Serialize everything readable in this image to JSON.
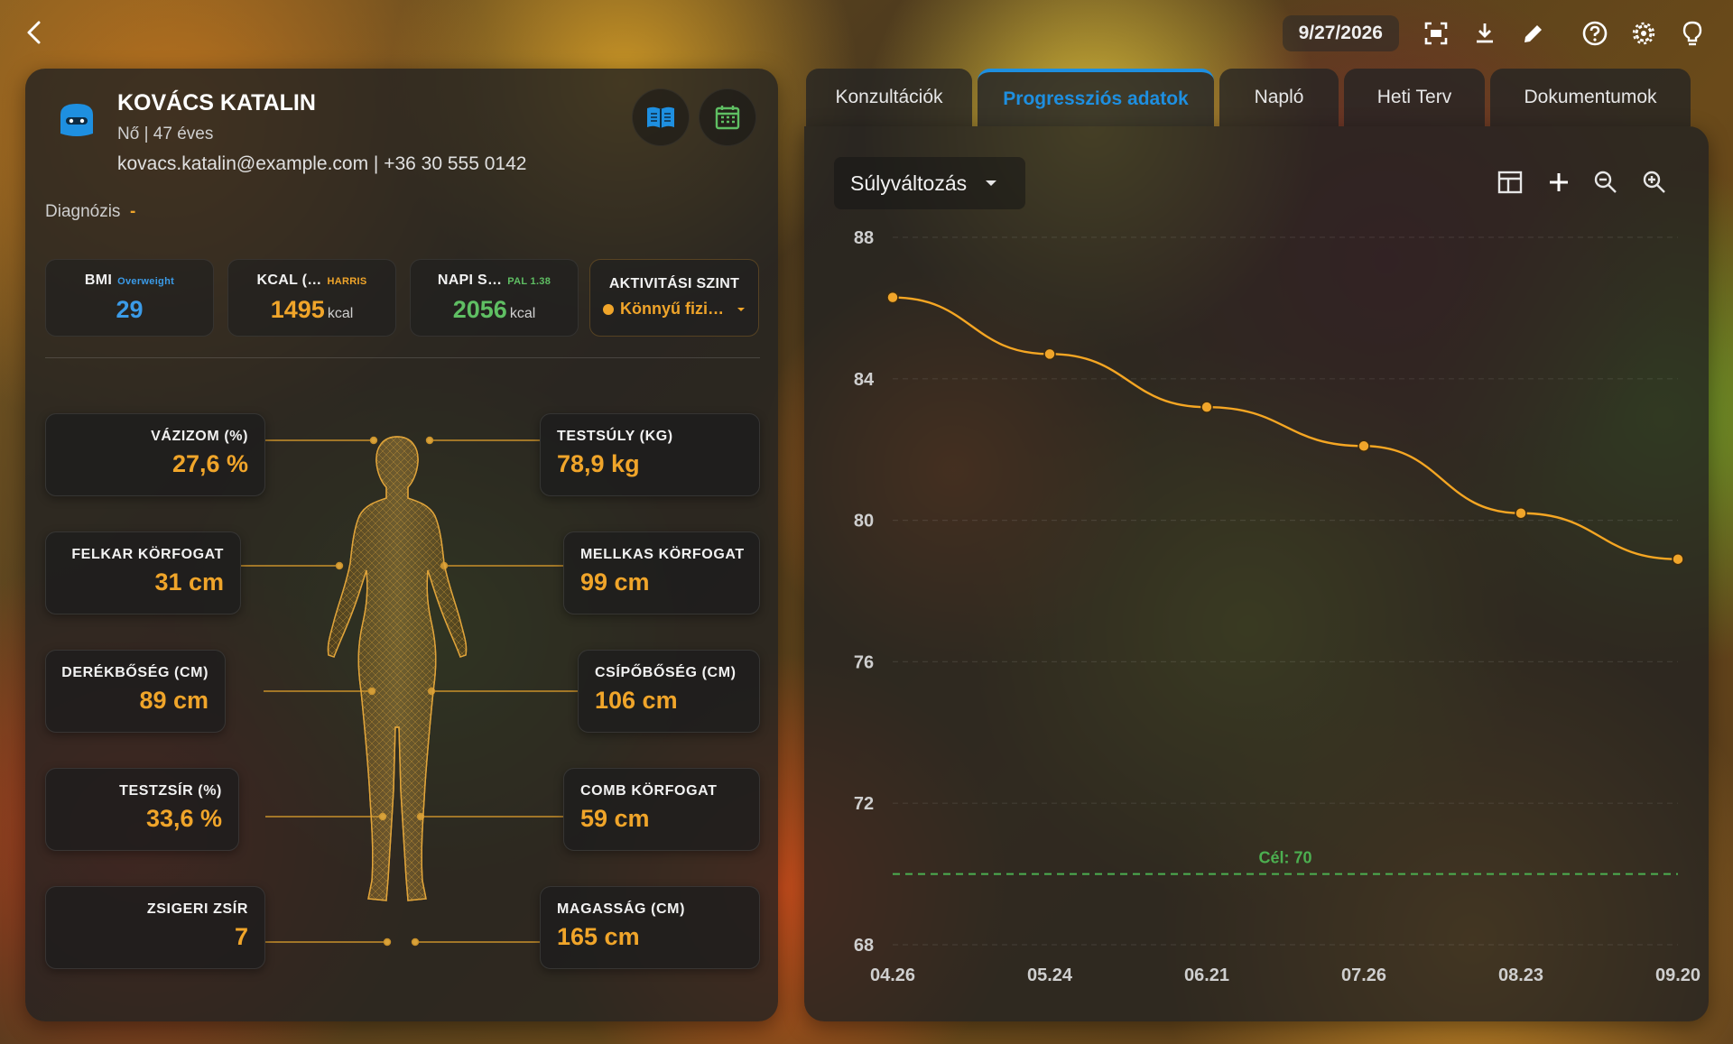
{
  "topbar": {
    "date": "9/27/2026",
    "icons": [
      "back-icon",
      "fullscreen-icon",
      "download-icon",
      "edit-icon",
      "help-icon",
      "settings-icon",
      "lightbulb-icon"
    ]
  },
  "patient": {
    "name": "KOVÁCS KATALIN",
    "meta": "Nő | 47 éves",
    "contact": "kovacs.katalin@example.com | +36 30 555 0142",
    "diagnosis_label": "Diagnózis",
    "diagnosis_value": "-"
  },
  "stats": {
    "bmi": {
      "title": "BMI",
      "tag": "Overweight",
      "value": "29",
      "tag_color": "#3b9be8",
      "value_color": "#3b9be8"
    },
    "kcal": {
      "title": "KCAL (…",
      "tag": "HARRIS",
      "value": "1495",
      "unit": "kcal",
      "tag_color": "#f0a52a",
      "value_color": "#f0a52a"
    },
    "napi": {
      "title": "NAPI S…",
      "tag": "PAL 1.38",
      "value": "2056",
      "unit": "kcal",
      "tag_color": "#5fbf63",
      "value_color": "#5fbf63"
    },
    "activity": {
      "title": "AKTIVITÁSI SZINT",
      "value": "Könnyű fizi…"
    }
  },
  "measurements": {
    "vazizom": {
      "label": "VÁZIZOM (%)",
      "value": "27,6 %"
    },
    "testsuly": {
      "label": "TESTSÚLY (KG)",
      "value": "78,9 kg"
    },
    "felkar": {
      "label": "FELKAR KÖRFOGAT",
      "value": "31 cm"
    },
    "mellkas": {
      "label": "MELLKAS KÖRFOGAT",
      "value": "99 cm"
    },
    "derek": {
      "label": "DERÉKBŐSÉG (CM)",
      "value": "89 cm"
    },
    "csipo": {
      "label": "CSÍPŐBŐSÉG (CM)",
      "value": "106 cm"
    },
    "testzsir": {
      "label": "TESTZSÍR (%)",
      "value": "33,6 %"
    },
    "comb": {
      "label": "COMB KÖRFOGAT",
      "value": "59 cm"
    },
    "zsigeri": {
      "label": "ZSIGERI ZSÍR",
      "value": "7"
    },
    "magassag": {
      "label": "MAGASSÁG (CM)",
      "value": "165 cm"
    }
  },
  "tabs": [
    {
      "label": "Konzultációk",
      "active": false
    },
    {
      "label": "Progressziós adatok",
      "active": true
    },
    {
      "label": "Napló",
      "active": false
    },
    {
      "label": "Heti Terv",
      "active": false
    },
    {
      "label": "Dokumentumok",
      "active": false
    }
  ],
  "chart_controls": {
    "select_value": "Súlyváltozás",
    "tools": [
      "table-icon",
      "add-icon",
      "zoom-out-icon",
      "zoom-in-icon"
    ]
  },
  "chart_data": {
    "type": "line",
    "title": "",
    "xlabel": "",
    "ylabel": "",
    "categories": [
      "04.26",
      "05.24",
      "06.21",
      "07.26",
      "08.23",
      "09.20"
    ],
    "series": [
      {
        "values": [
          86.3,
          84.7,
          83.2,
          82.1,
          80.2,
          78.9
        ]
      }
    ],
    "ylim": [
      68,
      88
    ],
    "yticks": [
      68,
      72,
      76,
      80,
      84,
      88
    ],
    "goal": {
      "value": 70,
      "label": "Cél: 70"
    },
    "grid": "horizontal",
    "colors": {
      "line": "#f5a623",
      "goal": "#4caf50"
    }
  }
}
